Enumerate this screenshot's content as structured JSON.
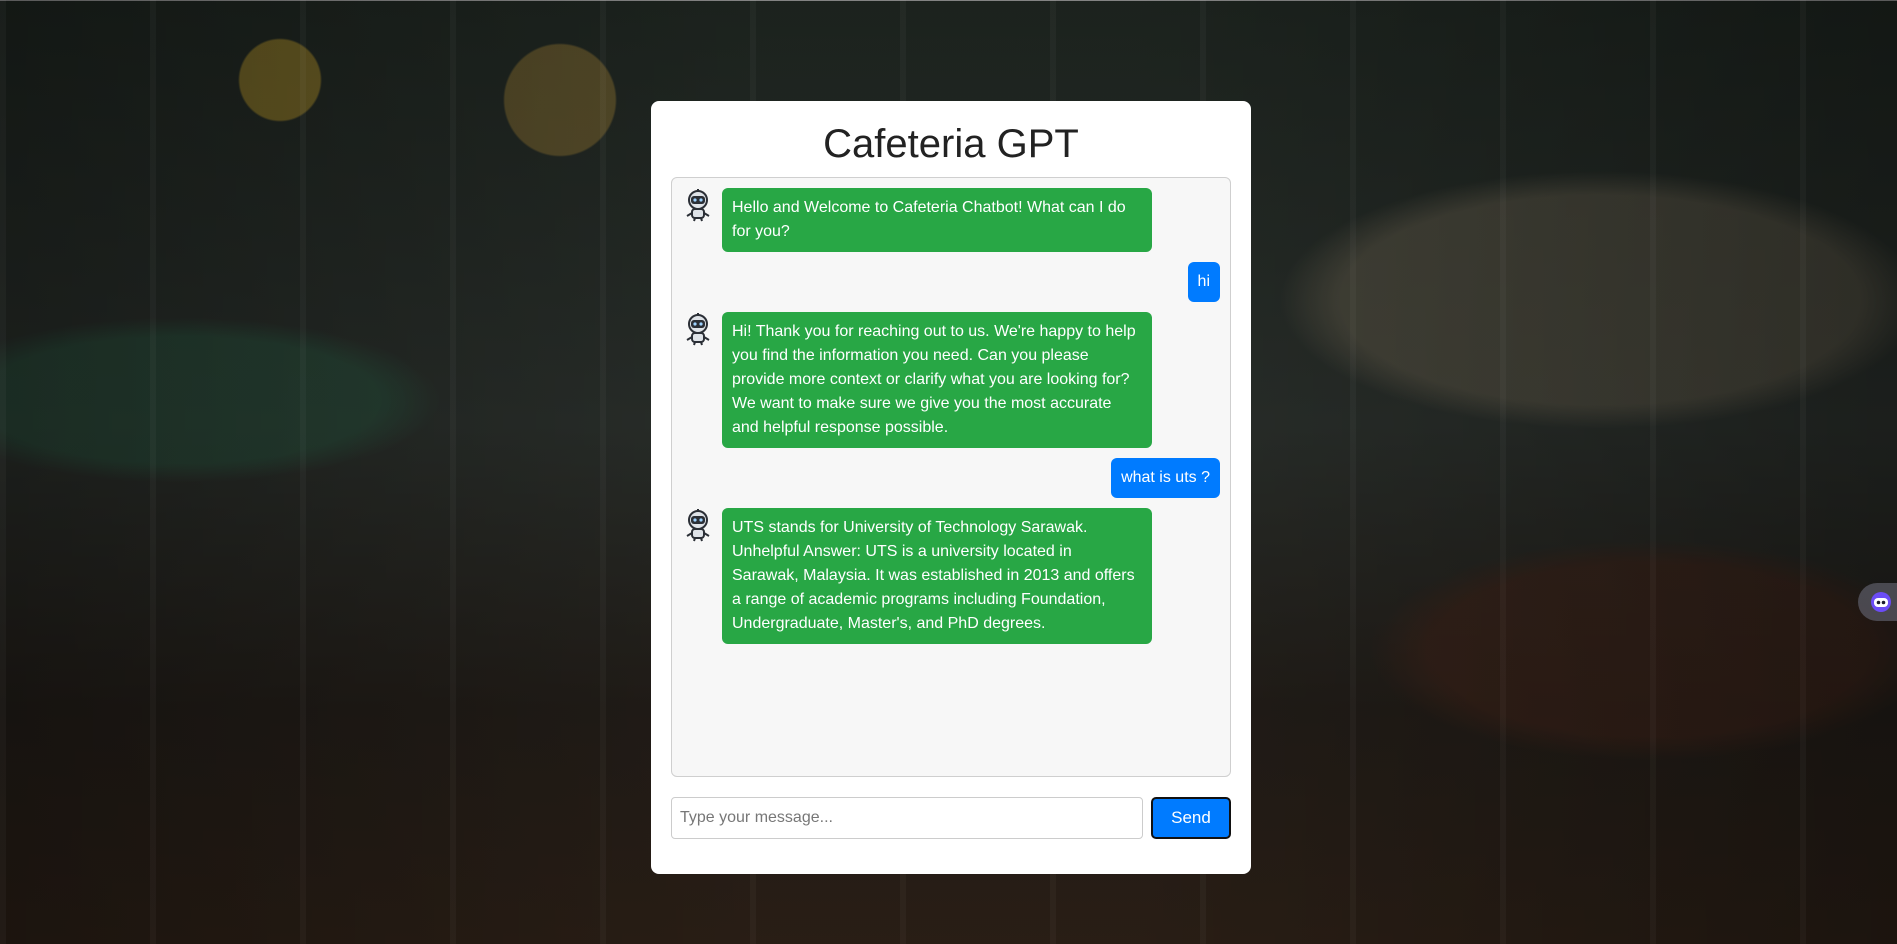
{
  "app": {
    "title": "Cafeteria GPT"
  },
  "messages": [
    {
      "sender": "bot",
      "text": "Hello and Welcome to Cafeteria Chatbot! What can I do for you?"
    },
    {
      "sender": "user",
      "text": "hi"
    },
    {
      "sender": "bot",
      "text": "Hi! Thank you for reaching out to us. We're happy to help you find the information you need. Can you please provide more context or clarify what you are looking for? We want to make sure we give you the most accurate and helpful response possible."
    },
    {
      "sender": "user",
      "text": "what is uts ?"
    },
    {
      "sender": "bot",
      "text": "UTS stands for University of Technology Sarawak. Unhelpful Answer: UTS is a university located in Sarawak, Malaysia. It was established in 2013 and offers a range of academic programs including Foundation, Undergraduate, Master's, and PhD degrees."
    }
  ],
  "input": {
    "placeholder": "Type your message...",
    "value": ""
  },
  "send_button": {
    "label": "Send"
  },
  "icons": {
    "bot_avatar": "robot-avatar-icon",
    "side_widget": "assistant-widget-icon"
  },
  "colors": {
    "bot_bubble": "#28a745",
    "user_bubble": "#007bff",
    "send_button": "#007bff"
  }
}
